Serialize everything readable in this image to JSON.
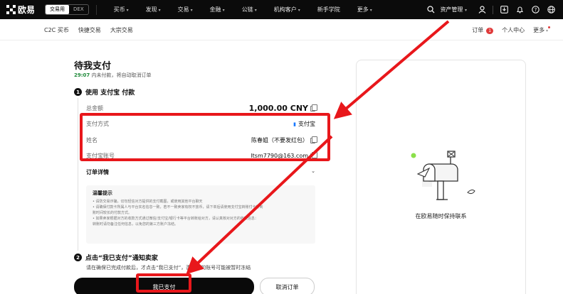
{
  "topbar": {
    "brand": "欧易",
    "mode_tabs": [
      "交易用",
      "DEX"
    ],
    "nav": [
      "买币",
      "发现",
      "交易",
      "金融",
      "公链",
      "机构客户",
      "新手学院",
      "更多"
    ],
    "nav_has_chevron": [
      true,
      true,
      true,
      true,
      true,
      true,
      false,
      true
    ],
    "asset_label": "资产管理"
  },
  "subnav": {
    "left": [
      "C2C 买币",
      "快捷交易",
      "大宗交易"
    ],
    "orders_label": "订单",
    "orders_count": "1",
    "user_center": "个人中心",
    "more": "更多"
  },
  "order": {
    "title": "待我支付",
    "timer": "29:07",
    "timer_suffix": "内未付款，将自动取消订单",
    "step1_num": "1",
    "step1_title": "使用 支付宝 付款",
    "total_label": "总金额",
    "total_value": "1,000.00 CNY",
    "method_label": "支付方式",
    "method_value": "支付宝",
    "name_label": "姓名",
    "name_value": "陈春姐（不要发红包）",
    "account_label": "支付宝账号",
    "account_value": "ltsm7790@163.com",
    "details_label": "订单详情",
    "notice_title": "温馨提示",
    "notice_lines": [
      "• 请防交易诈骗，切勿轻信对方提供的支付截图，或使用其他平台聊天",
      "• 请确保付款卡所属人与平台实名信息一致，若不一致卖家有权不放币，请下单后请使用支付宝转账付卡等到",
      "  账时间较长的付款方式。",
      "• 如果卖家根据对方的收款方式通过微信/支付宝/银行卡等平台转账给对方，请认真核对对方的收款信息：",
      "  转账时请勿备注任何信息，以免您的第三方账户冻结。"
    ],
    "step2_num": "2",
    "step2_title": "点击“我已支付”通知卖家",
    "step2_desc": "请在确保已完成付款后，才点击“我已支付”，否则您的账号可能被暂时冻结",
    "pay_button": "我已支付",
    "cancel_button": "取消订单"
  },
  "panel": {
    "caption": "在欧易随时保持联系"
  },
  "colors": {
    "annotation": "#e8171b",
    "timer": "#1f8a3a",
    "badge": "#e03a3a"
  }
}
